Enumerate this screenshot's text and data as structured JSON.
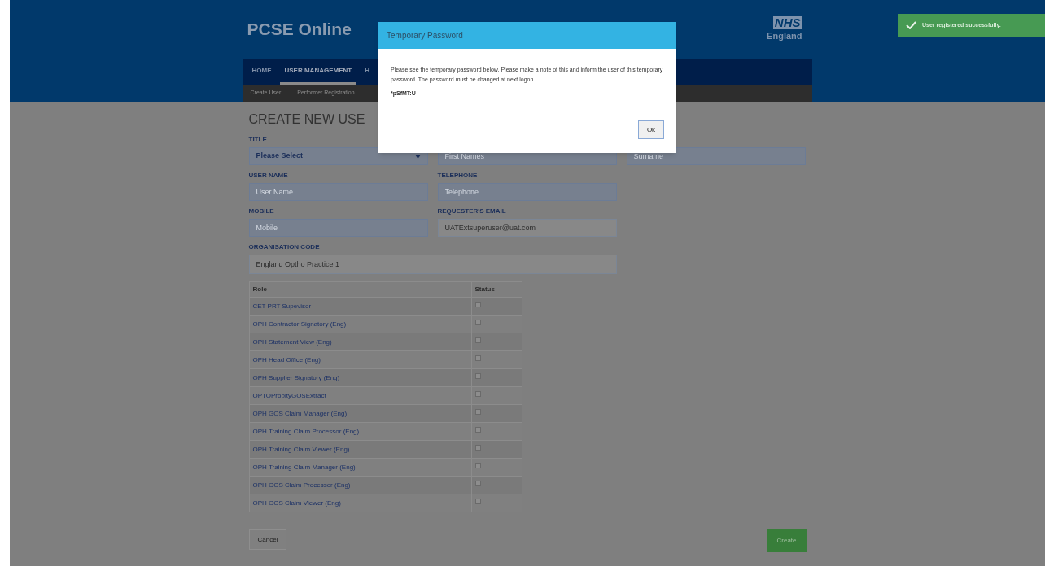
{
  "header": {
    "title": "PCSE Online",
    "logo_mark": "NHS",
    "logo_subtitle": "England"
  },
  "nav": [
    {
      "label": "HOME",
      "selected": false
    },
    {
      "label": "USER MANAGEMENT",
      "selected": true
    },
    {
      "label": "H",
      "selected": false
    }
  ],
  "subnav": [
    {
      "label": "Create User"
    },
    {
      "label": "Performer Registration"
    }
  ],
  "form": {
    "heading": "CREATE NEW USE",
    "rows": [
      [
        {
          "kind": "select",
          "label": "TITLE",
          "value": "Please Select"
        },
        {
          "kind": "input",
          "placeholder": "First Names"
        },
        {
          "kind": "input",
          "placeholder": "Surname"
        }
      ],
      [
        {
          "kind": "input",
          "label": "USER NAME",
          "placeholder": "User Name"
        },
        {
          "kind": "input",
          "label": "TELEPHONE",
          "placeholder": "Telephone"
        }
      ],
      [
        {
          "kind": "input",
          "label": "MOBILE",
          "placeholder": "Mobile"
        },
        {
          "kind": "readonly",
          "label": "REQUESTER'S EMAIL",
          "value": "UATExtsuperuser@uat.com"
        }
      ],
      [
        {
          "kind": "readonly_wide",
          "label": "ORGANISATION CODE",
          "value": "England Optho Practice 1"
        }
      ]
    ]
  },
  "roles_table": {
    "columns": [
      "Role",
      "Status"
    ],
    "rows": [
      {
        "role": "CET PRT Supevisor",
        "checked": false
      },
      {
        "role": "OPH Contractor Signatory (Eng)",
        "checked": false
      },
      {
        "role": "OPH Statement View (Eng)",
        "checked": false
      },
      {
        "role": "OPH Head Office (Eng)",
        "checked": false
      },
      {
        "role": "OPH Supplier Signatory (Eng)",
        "checked": false
      },
      {
        "role": "OPTOProbityGOSExtract",
        "checked": false
      },
      {
        "role": "OPH GOS Claim Manager (Eng)",
        "checked": false
      },
      {
        "role": "OPH Training Claim Processor (Eng)",
        "checked": false
      },
      {
        "role": "OPH Training Claim Viewer (Eng)",
        "checked": false
      },
      {
        "role": "OPH Training Claim Manager (Eng)",
        "checked": false
      },
      {
        "role": "OPH GOS Claim Processor (Eng)",
        "checked": false
      },
      {
        "role": "OPH GOS Claim Viewer (Eng)",
        "checked": false
      }
    ]
  },
  "buttons": {
    "cancel": "Cancel",
    "create": "Create"
  },
  "dialog": {
    "title": "Temporary Password",
    "message": "Please see the temporary password below. Please make a note of this and inform the user of this temporary password. The password must be changed at next logon.",
    "password": "*pSfMT:U",
    "ok": "Ok"
  },
  "toast": {
    "message": "User registered successfully."
  }
}
